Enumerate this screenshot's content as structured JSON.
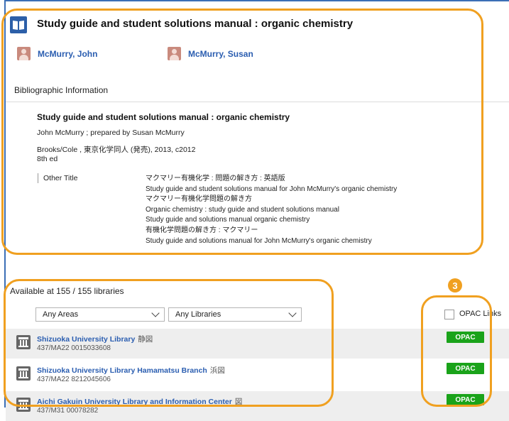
{
  "record": {
    "title": "Study guide and student solutions manual : organic chemistry",
    "authors": [
      {
        "name": "McMurry, John"
      },
      {
        "name": "McMurry, Susan"
      }
    ]
  },
  "bibliographic": {
    "section_title": "Bibliographic Information",
    "title": "Study guide and student solutions manual : organic chemistry",
    "responsibility": "John McMurry ; prepared by Susan McMurry",
    "publisher": "Brooks/Cole , 東京化学同人 (発売), 2013, c2012",
    "edition": "8th ed",
    "other_title_label": "Other Title",
    "other_titles": [
      "マクマリー有機化学 : 問題の解き方 : 英語版",
      "Study guide and student solutions manual for John McMurry's organic chemistry",
      "マクマリー有機化学問題の解き方",
      "Organic chemistry : study guide and student solutions manual",
      "Study guide and solutions manual organic chemistry",
      "有機化学問題の解き方 : マクマリー",
      "Study guide and solutions manual for John McMurry's organic chemistry"
    ]
  },
  "holdings": {
    "available_text": "Available at 155 / 155 libraries",
    "area_select": "Any Areas",
    "library_select": "Any Libraries",
    "opac_links_label": "OPAC Links",
    "libraries": [
      {
        "name": "Shizuoka University Library",
        "abbr": "静図",
        "call": "437/MA22  0015033608",
        "opac": "OPAC"
      },
      {
        "name": "Shizuoka University Library Hamamatsu Branch",
        "abbr": "浜図",
        "call": "437/MA22  8212045606",
        "opac": "OPAC"
      },
      {
        "name": "Aichi Gakuin University Library and Information Center",
        "abbr": "図",
        "call": "437/M31  00078282",
        "opac": "OPAC"
      }
    ]
  },
  "annotation": {
    "badge": "3",
    "color": "#f0a020"
  },
  "colors": {
    "link": "#2a5db0",
    "opac_button": "#1aa31a",
    "frame": "#3b6fb6"
  }
}
